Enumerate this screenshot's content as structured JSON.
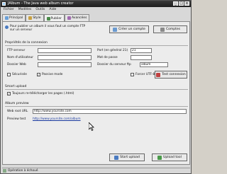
{
  "window": {
    "title": "JAlbum - The Java web album creator"
  },
  "menu": [
    "Fichier",
    "Modèles",
    "Outils",
    "Aide"
  ],
  "tabs": [
    {
      "label": "Principal",
      "color": "#6aa0d8"
    },
    {
      "label": "Style",
      "color": "#c8a040"
    },
    {
      "label": "Publier",
      "color": "#4a8a4a"
    },
    {
      "label": "Avancées",
      "color": "#a06ab0"
    }
  ],
  "publish_hint": "Pour publier un album il vous faut un compte FTP sur un serveur",
  "buttons": {
    "create_account": "Créer un compte",
    "accounts": "Comptes",
    "test_connection": "Test connexion",
    "start_upload": "Start upload",
    "upload_tool": "Upload tool"
  },
  "connection": {
    "section_title": "Propriétés de la connexion",
    "ftp_server_label": "FTP serveur",
    "ftp_server_value": "",
    "port_label": "Port (en général 21)",
    "port_value": "21",
    "username_label": "Nom d'utilisateur",
    "username_value": "",
    "password_label": "Mot de passe",
    "password_value": "",
    "web_dir_label": "Dossier Web",
    "web_dir_value": "",
    "server_dir_label": "Dossier du serveur ftp",
    "server_dir_value": "album",
    "secure_label": "Sécurisée",
    "passive_label": "Passive mode",
    "passive_checked": true,
    "secure_checked": false,
    "utf8_label": "Forcer UTF-8",
    "utf8_checked": false
  },
  "smart_upload": {
    "section_title": "Smart upload",
    "always_label": "Toujours re-télécharger les pages (.html)",
    "always_checked": true
  },
  "album_preview": {
    "section_title": "Album preview",
    "web_root_label": "Web root URL",
    "web_root_value": "http://www.yoursite.com",
    "preview_label": "Preview test",
    "preview_link": "http://www.yoursite.com/album"
  },
  "status": {
    "text": "Opération à échoué"
  }
}
